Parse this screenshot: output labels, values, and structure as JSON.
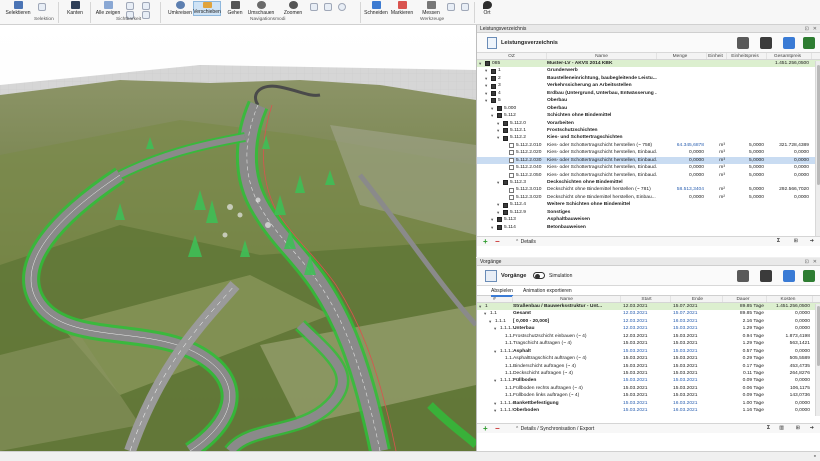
{
  "ribbon": {
    "buttons": [
      {
        "label": "Selektieren",
        "icon": "select-icon"
      },
      {
        "label": "Kanten",
        "icon": "edges-icon"
      },
      {
        "label": "Alle zeigen",
        "icon": "show-all-icon"
      },
      {
        "label": "Umkreisen",
        "icon": "orbit-icon"
      },
      {
        "label": "Verschieben",
        "icon": "pan-icon"
      },
      {
        "label": "Gehen",
        "icon": "walk-icon"
      },
      {
        "label": "Umschauen",
        "icon": "look-around-icon"
      },
      {
        "label": "Zoomen",
        "icon": "zoom-icon"
      },
      {
        "label": "Schneiden",
        "icon": "cut-icon"
      },
      {
        "label": "Markieren",
        "icon": "mark-icon"
      },
      {
        "label": "Messen",
        "icon": "measure-icon"
      },
      {
        "label": "Ort",
        "icon": "location-icon"
      }
    ],
    "groups": [
      "Selektion",
      "Sichtbarkeit",
      "Navigationsmodi",
      "Werkzeuge"
    ]
  },
  "lv_panel": {
    "window_title": "Leistungsverzeichnis",
    "toolbar_title": "Leistungsverzeichnis",
    "columns": [
      "OZ",
      "Name",
      "Menge",
      "Einheit",
      "Einheitspreis",
      "Gesamtpreis"
    ],
    "rows": [
      {
        "oz": "085",
        "name": "Muster-LV - AKVS 2014 KBK",
        "menge": "",
        "einheit": "",
        "ep": "",
        "gp": "1.451.256,0500",
        "level": 0,
        "bold": true,
        "green": true
      },
      {
        "oz": "1",
        "name": "Grunderwerb",
        "menge": "",
        "einheit": "",
        "ep": "",
        "gp": "",
        "level": 1,
        "bold": true
      },
      {
        "oz": "2",
        "name": "Baustelleneinrichtung, baubegleitende Leistu...",
        "menge": "",
        "einheit": "",
        "ep": "",
        "gp": "",
        "level": 1,
        "bold": true
      },
      {
        "oz": "3",
        "name": "Verkehrssicherung an Arbeitsstellen",
        "menge": "",
        "einheit": "",
        "ep": "",
        "gp": "",
        "level": 1,
        "bold": true
      },
      {
        "oz": "4",
        "name": "Erdbau (Untergrund, Unterbau, Entwässerung ...",
        "menge": "",
        "einheit": "",
        "ep": "",
        "gp": "",
        "level": 1,
        "bold": true
      },
      {
        "oz": "5",
        "name": "Oberbau",
        "menge": "",
        "einheit": "",
        "ep": "",
        "gp": "",
        "level": 1,
        "bold": true
      },
      {
        "oz": "5.000",
        "name": "Oberbau",
        "menge": "",
        "einheit": "",
        "ep": "",
        "gp": "",
        "level": 2,
        "bold": true
      },
      {
        "oz": "5.112",
        "name": "Schichten ohne Bindemittel",
        "menge": "",
        "einheit": "",
        "ep": "",
        "gp": "",
        "level": 2,
        "bold": true
      },
      {
        "oz": "5.112.0",
        "name": "Vorarbeiten",
        "menge": "",
        "einheit": "",
        "ep": "",
        "gp": "",
        "level": 3,
        "bold": true
      },
      {
        "oz": "5.112.1",
        "name": "Frostschutzschichten",
        "menge": "",
        "einheit": "",
        "ep": "",
        "gp": "",
        "level": 3,
        "bold": true
      },
      {
        "oz": "5.112.2",
        "name": "Kies- und Schottertragschichten",
        "menge": "",
        "einheit": "",
        "ep": "",
        "gp": "",
        "level": 3,
        "bold": true
      },
      {
        "oz": "5.112.2.010",
        "name": "Kies- oder Schottertragschicht herstellen (~ 758)",
        "menge": "64.345,6878",
        "einheit": "m³",
        "ep": "5,0000",
        "gp": "321.728,4389",
        "level": 4,
        "blue": true
      },
      {
        "oz": "5.112.2.020",
        "name": "Kies- oder Schottertragschicht herstellen, Einbaud...",
        "menge": "0,0000",
        "einheit": "m³",
        "ep": "5,0000",
        "gp": "0,0000",
        "level": 4
      },
      {
        "oz": "5.112.2.030",
        "name": "Kies- oder Schottertragschicht herstellen, Einbaud...",
        "menge": "0,0000",
        "einheit": "m³",
        "ep": "5,0000",
        "gp": "0,0000",
        "level": 4,
        "hl": true
      },
      {
        "oz": "5.112.2.040",
        "name": "Kies- oder Schottertragschicht herstellen, Einbaud...",
        "menge": "0,0000",
        "einheit": "m³",
        "ep": "5,0000",
        "gp": "0,0000",
        "level": 4
      },
      {
        "oz": "5.112.2.050",
        "name": "Kies- oder Schottertragschicht herstellen, Einbaud...",
        "menge": "0,0000",
        "einheit": "m³",
        "ep": "5,0000",
        "gp": "0,0000",
        "level": 4
      },
      {
        "oz": "5.112.3",
        "name": "Deckschichten ohne Bindemittel",
        "menge": "",
        "einheit": "",
        "ep": "",
        "gp": "",
        "level": 3,
        "bold": true
      },
      {
        "oz": "5.112.3.010",
        "name": "Deckschicht ohne Bindemittel herstellen (~ 781)",
        "menge": "58.513,3404",
        "einheit": "m²",
        "ep": "5,0000",
        "gp": "292.566,7020",
        "level": 4,
        "blue": true
      },
      {
        "oz": "5.112.3.020",
        "name": "Deckschicht ohne Bindemittel herstellen, Einbau...",
        "menge": "0,0000",
        "einheit": "m²",
        "ep": "5,0000",
        "gp": "0,0000",
        "level": 4
      },
      {
        "oz": "5.112.4",
        "name": "Weitere Schichten ohne Bindemittel",
        "menge": "",
        "einheit": "",
        "ep": "",
        "gp": "",
        "level": 3,
        "bold": true
      },
      {
        "oz": "5.112.9",
        "name": "Sonstiges",
        "menge": "",
        "einheit": "",
        "ep": "",
        "gp": "",
        "level": 3,
        "bold": true
      },
      {
        "oz": "5.113",
        "name": "Asphaltbauweisen",
        "menge": "",
        "einheit": "",
        "ep": "",
        "gp": "",
        "level": 2,
        "bold": true
      },
      {
        "oz": "5.114",
        "name": "Betonbauweisen",
        "menge": "",
        "einheit": "",
        "ep": "",
        "gp": "",
        "level": 2,
        "bold": true
      }
    ],
    "footer_label": "Details"
  },
  "vg_panel": {
    "window_title": "Vorgänge",
    "toolbar_title": "Vorgänge",
    "simulation_label": "Simulation",
    "tabs": [
      "Abspielen",
      "Animation exportieren"
    ],
    "columns": [
      "#",
      "Name",
      "Start",
      "Ende",
      "Dauer",
      "Kosten"
    ],
    "rows": [
      {
        "nr": "1",
        "name": "Straßenbau / Bauwerksstruktur - Unt...",
        "start": "12.03.2021",
        "ende": "15.07.2021",
        "dauer": "89.85 Tage",
        "kosten": "1.451.256,0500",
        "level": 0,
        "bold": true,
        "green": true
      },
      {
        "nr": "1.1",
        "name": "Gesamt",
        "start": "12.03.2021",
        "ende": "15.07.2021",
        "dauer": "89.85 Tage",
        "kosten": "0,0000",
        "level": 1,
        "bold": true,
        "blue": true
      },
      {
        "nr": "1.1.1",
        "name": "[   0,000 -     20,000]",
        "start": "12.03.2021",
        "ende": "16.03.2021",
        "dauer": "2.16 Tage",
        "kosten": "0,0000",
        "level": 2,
        "bold": true,
        "blue": true
      },
      {
        "nr": "1.1.1.1",
        "name": "Unterbau",
        "start": "12.03.2021",
        "ende": "15.03.2021",
        "dauer": "1.29 Tage",
        "kosten": "0,0000",
        "level": 3,
        "bold": true,
        "blue": true
      },
      {
        "nr": "1.1...",
        "name": "Frostschutzschicht einbauen (~ 4)",
        "start": "12.03.2021",
        "ende": "15.03.2021",
        "dauer": "0.94 Tage",
        "kosten": "1.873,4198",
        "level": 4
      },
      {
        "nr": "1.1...",
        "name": "Tragschicht auftragen (~ 4)",
        "start": "15.03.2021",
        "ende": "15.03.2021",
        "dauer": "1.29 Tage",
        "kosten": "563,1421",
        "level": 4
      },
      {
        "nr": "1.1.1.2",
        "name": "Asphalt",
        "start": "15.03.2021",
        "ende": "15.03.2021",
        "dauer": "0.57 Tage",
        "kosten": "0,0000",
        "level": 3,
        "bold": true,
        "blue": true
      },
      {
        "nr": "1.1...",
        "name": "Asphalttragschicht auftragen (~ 4)",
        "start": "15.03.2021",
        "ende": "15.03.2021",
        "dauer": "0.29 Tage",
        "kosten": "505,5589",
        "level": 4
      },
      {
        "nr": "1.1...",
        "name": "Binderschicht auftragen (~ 4)",
        "start": "15.03.2021",
        "ende": "15.03.2021",
        "dauer": "0.17 Tage",
        "kosten": "453,4735",
        "level": 4
      },
      {
        "nr": "1.1...",
        "name": "Deckschicht auftragen (~ 4)",
        "start": "15.03.2021",
        "ende": "15.03.2021",
        "dauer": "0.11 Tage",
        "kosten": "264,8276",
        "level": 4
      },
      {
        "nr": "1.1.1.3",
        "name": "Füllboden",
        "start": "15.03.2021",
        "ende": "15.03.2021",
        "dauer": "0.09 Tage",
        "kosten": "0,0000",
        "level": 3,
        "bold": true,
        "blue": true
      },
      {
        "nr": "1.1...",
        "name": "Füllboden rechts auftragen (~ 4)",
        "start": "15.03.2021",
        "ende": "15.03.2021",
        "dauer": "0.06 Tage",
        "kosten": "106,1175",
        "level": 4
      },
      {
        "nr": "1.1...",
        "name": "Füllboden links auftragen (~ 4)",
        "start": "15.03.2021",
        "ende": "15.03.2021",
        "dauer": "0.09 Tage",
        "kosten": "143,0736",
        "level": 4
      },
      {
        "nr": "1.1.1.4",
        "name": "Bankettbefestigung",
        "start": "15.03.2021",
        "ende": "16.03.2021",
        "dauer": "1.00 Tage",
        "kosten": "0,0000",
        "level": 3,
        "bold": true,
        "blue": true
      },
      {
        "nr": "1.1.1.5",
        "name": "Oberboden",
        "start": "15.03.2021",
        "ende": "16.03.2021",
        "dauer": "1.16 Tage",
        "kosten": "0,0000",
        "level": 3,
        "bold": true,
        "blue": true
      }
    ],
    "footer_label": "Details / Synchronisation / Export"
  },
  "colors": {
    "accent": "#3a7bd5",
    "selection": "#c9dcf2",
    "total_row": "#dcefcf",
    "road_green": "#2fbf3a",
    "terrain": "#6e7a48"
  }
}
